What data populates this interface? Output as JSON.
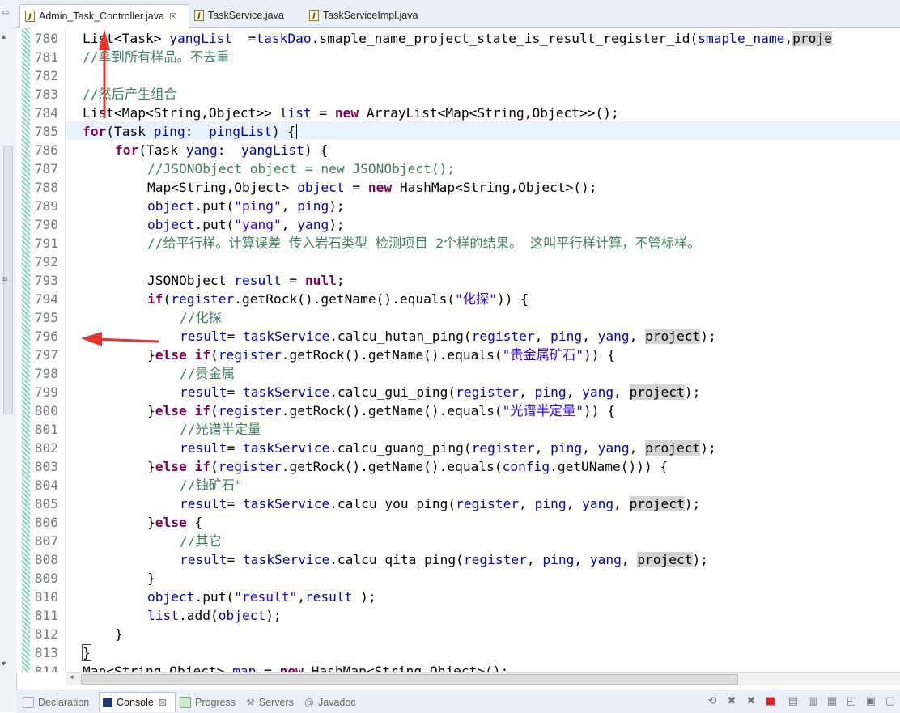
{
  "tabs": [
    {
      "label": "Admin_Task_Controller.java",
      "active": true,
      "close": "☒"
    },
    {
      "label": "TaskService.java",
      "active": false
    },
    {
      "label": "TaskServiceImpl.java",
      "active": false
    }
  ],
  "bottom_tabs": [
    {
      "label": "Declaration"
    },
    {
      "label": "Console",
      "active": true,
      "close": "☒"
    },
    {
      "label": "Progress"
    },
    {
      "label": "Servers"
    },
    {
      "label": "Javadoc"
    }
  ],
  "colors": {
    "keyword": "#7f0055",
    "comment": "#3f7f5f",
    "string": "#2a00ff",
    "field": "#0000c0",
    "annotation_arrow": "#e8322c"
  },
  "code_lines": [
    {
      "n": "780",
      "indent": 2,
      "tokens": [
        [
          "t",
          "List<Task> "
        ],
        [
          "f",
          "yangList"
        ],
        [
          "t",
          "  ="
        ],
        [
          "f",
          "taskDao"
        ],
        [
          "t",
          ".smaple_name_project_state_is_result_register_id("
        ],
        [
          "f",
          "smaple_name"
        ],
        [
          "t",
          ","
        ],
        [
          "h",
          "proje"
        ]
      ]
    },
    {
      "n": "781",
      "indent": 2,
      "tokens": [
        [
          "c",
          "//拿到所有样品。不去重"
        ]
      ]
    },
    {
      "n": "782",
      "indent": 0,
      "tokens": []
    },
    {
      "n": "783",
      "indent": 2,
      "tokens": [
        [
          "c",
          "//然后产生组合"
        ]
      ]
    },
    {
      "n": "784",
      "indent": 2,
      "tokens": [
        [
          "t",
          "List<Map<String,Object>> "
        ],
        [
          "f",
          "list"
        ],
        [
          "t",
          " = "
        ],
        [
          "k",
          "new"
        ],
        [
          "t",
          " ArrayList<Map<String,Object>>();"
        ]
      ]
    },
    {
      "n": "785",
      "indent": 2,
      "tokens": [
        [
          "k",
          "for"
        ],
        [
          "t",
          "(Task "
        ],
        [
          "f",
          "ping"
        ],
        [
          "t",
          ":  "
        ],
        [
          "f",
          "pingList"
        ],
        [
          "t",
          ") {"
        ],
        [
          "caret",
          ""
        ]
      ]
    },
    {
      "n": "786",
      "indent": 3,
      "tokens": [
        [
          "k",
          "for"
        ],
        [
          "t",
          "(Task "
        ],
        [
          "f",
          "yang"
        ],
        [
          "t",
          ":  "
        ],
        [
          "f",
          "yangList"
        ],
        [
          "t",
          ") {"
        ]
      ]
    },
    {
      "n": "787",
      "indent": 4,
      "tokens": [
        [
          "c",
          "//JSONObject object = new JSONObject();"
        ]
      ]
    },
    {
      "n": "788",
      "indent": 4,
      "tokens": [
        [
          "t",
          "Map<String,Object> "
        ],
        [
          "f",
          "object"
        ],
        [
          "t",
          " = "
        ],
        [
          "k",
          "new"
        ],
        [
          "t",
          " HashMap<String,Object>();"
        ]
      ]
    },
    {
      "n": "789",
      "indent": 4,
      "tokens": [
        [
          "f",
          "object"
        ],
        [
          "t",
          ".put("
        ],
        [
          "s",
          "\"ping\""
        ],
        [
          "t",
          ", "
        ],
        [
          "f",
          "ping"
        ],
        [
          "t",
          ");"
        ]
      ]
    },
    {
      "n": "790",
      "indent": 4,
      "tokens": [
        [
          "f",
          "object"
        ],
        [
          "t",
          ".put("
        ],
        [
          "s",
          "\"yang\""
        ],
        [
          "t",
          ", "
        ],
        [
          "f",
          "yang"
        ],
        [
          "t",
          ");"
        ]
      ]
    },
    {
      "n": "791",
      "indent": 4,
      "tokens": [
        [
          "c",
          "//给平行样。计算误差 传入岩石类型 检测项目 2个样的结果。 这叫平行样计算，不管标样。"
        ]
      ]
    },
    {
      "n": "792",
      "indent": 0,
      "tokens": []
    },
    {
      "n": "793",
      "indent": 4,
      "tokens": [
        [
          "t",
          "JSONObject "
        ],
        [
          "f",
          "result"
        ],
        [
          "t",
          " = "
        ],
        [
          "k",
          "null"
        ],
        [
          "t",
          ";"
        ]
      ]
    },
    {
      "n": "794",
      "indent": 4,
      "tokens": [
        [
          "k",
          "if"
        ],
        [
          "t",
          "("
        ],
        [
          "f",
          "register"
        ],
        [
          "t",
          ".getRock().getName().equals("
        ],
        [
          "s",
          "\"化探\""
        ],
        [
          "t",
          ")) {"
        ]
      ]
    },
    {
      "n": "795",
      "indent": 5,
      "tokens": [
        [
          "c",
          "//化探"
        ]
      ]
    },
    {
      "n": "796",
      "indent": 5,
      "tokens": [
        [
          "f",
          "result"
        ],
        [
          "t",
          "= "
        ],
        [
          "d",
          "taskService"
        ],
        [
          "t",
          ".calcu_hutan_ping("
        ],
        [
          "f",
          "register"
        ],
        [
          "t",
          ", "
        ],
        [
          "f",
          "ping"
        ],
        [
          "t",
          ", "
        ],
        [
          "f",
          "yang"
        ],
        [
          "t",
          ", "
        ],
        [
          "h",
          "project"
        ],
        [
          "t",
          ");"
        ]
      ]
    },
    {
      "n": "797",
      "indent": 4,
      "tokens": [
        [
          "t",
          "}"
        ],
        [
          "k",
          "else"
        ],
        [
          "t",
          " "
        ],
        [
          "k",
          "if"
        ],
        [
          "t",
          "("
        ],
        [
          "f",
          "register"
        ],
        [
          "t",
          ".getRock().getName().equals("
        ],
        [
          "s",
          "\"贵金属矿石\""
        ],
        [
          "t",
          ")) {"
        ]
      ]
    },
    {
      "n": "798",
      "indent": 5,
      "tokens": [
        [
          "c",
          "//贵金属"
        ]
      ]
    },
    {
      "n": "799",
      "indent": 5,
      "tokens": [
        [
          "f",
          "result"
        ],
        [
          "t",
          "= "
        ],
        [
          "d",
          "taskService"
        ],
        [
          "t",
          ".calcu_gui_ping("
        ],
        [
          "f",
          "register"
        ],
        [
          "t",
          ", "
        ],
        [
          "f",
          "ping"
        ],
        [
          "t",
          ", "
        ],
        [
          "f",
          "yang"
        ],
        [
          "t",
          ", "
        ],
        [
          "h",
          "project"
        ],
        [
          "t",
          ");"
        ]
      ]
    },
    {
      "n": "800",
      "indent": 4,
      "tokens": [
        [
          "t",
          "}"
        ],
        [
          "k",
          "else"
        ],
        [
          "t",
          " "
        ],
        [
          "k",
          "if"
        ],
        [
          "t",
          "("
        ],
        [
          "f",
          "register"
        ],
        [
          "t",
          ".getRock().getName().equals("
        ],
        [
          "s",
          "\"光谱半定量\""
        ],
        [
          "t",
          ")) {"
        ]
      ]
    },
    {
      "n": "801",
      "indent": 5,
      "tokens": [
        [
          "c",
          "//光谱半定量"
        ]
      ]
    },
    {
      "n": "802",
      "indent": 5,
      "tokens": [
        [
          "f",
          "result"
        ],
        [
          "t",
          "= "
        ],
        [
          "d",
          "taskService"
        ],
        [
          "t",
          ".calcu_guang_ping("
        ],
        [
          "f",
          "register"
        ],
        [
          "t",
          ", "
        ],
        [
          "f",
          "ping"
        ],
        [
          "t",
          ", "
        ],
        [
          "f",
          "yang"
        ],
        [
          "t",
          ", "
        ],
        [
          "h",
          "project"
        ],
        [
          "t",
          ");"
        ]
      ]
    },
    {
      "n": "803",
      "indent": 4,
      "tokens": [
        [
          "t",
          "}"
        ],
        [
          "k",
          "else"
        ],
        [
          "t",
          " "
        ],
        [
          "k",
          "if"
        ],
        [
          "t",
          "("
        ],
        [
          "f",
          "register"
        ],
        [
          "t",
          ".getRock().getName().equals("
        ],
        [
          "f",
          "config"
        ],
        [
          "t",
          ".getUName())) {"
        ]
      ]
    },
    {
      "n": "804",
      "indent": 5,
      "tokens": [
        [
          "c",
          "//铀矿石\""
        ]
      ]
    },
    {
      "n": "805",
      "indent": 5,
      "tokens": [
        [
          "f",
          "result"
        ],
        [
          "t",
          "= "
        ],
        [
          "d",
          "taskService"
        ],
        [
          "t",
          ".calcu_you_ping("
        ],
        [
          "f",
          "register"
        ],
        [
          "t",
          ", "
        ],
        [
          "f",
          "ping"
        ],
        [
          "t",
          ", "
        ],
        [
          "f",
          "yang"
        ],
        [
          "t",
          ", "
        ],
        [
          "h",
          "project"
        ],
        [
          "t",
          ");"
        ]
      ]
    },
    {
      "n": "806",
      "indent": 4,
      "tokens": [
        [
          "t",
          "}"
        ],
        [
          "k",
          "else"
        ],
        [
          "t",
          " {"
        ]
      ]
    },
    {
      "n": "807",
      "indent": 5,
      "tokens": [
        [
          "c",
          "//其它"
        ]
      ]
    },
    {
      "n": "808",
      "indent": 5,
      "tokens": [
        [
          "f",
          "result"
        ],
        [
          "t",
          "= "
        ],
        [
          "d",
          "taskService"
        ],
        [
          "t",
          ".calcu_qita_ping("
        ],
        [
          "f",
          "register"
        ],
        [
          "t",
          ", "
        ],
        [
          "f",
          "ping"
        ],
        [
          "t",
          ", "
        ],
        [
          "f",
          "yang"
        ],
        [
          "t",
          ", "
        ],
        [
          "h",
          "project"
        ],
        [
          "t",
          ");"
        ]
      ]
    },
    {
      "n": "809",
      "indent": 4,
      "tokens": [
        [
          "t",
          "}"
        ]
      ]
    },
    {
      "n": "810",
      "indent": 4,
      "tokens": [
        [
          "f",
          "object"
        ],
        [
          "t",
          ".put("
        ],
        [
          "s",
          "\"result\""
        ],
        [
          "t",
          ","
        ],
        [
          "f",
          "result"
        ],
        [
          "t",
          " );"
        ]
      ]
    },
    {
      "n": "811",
      "indent": 4,
      "tokens": [
        [
          "f",
          "list"
        ],
        [
          "t",
          ".add("
        ],
        [
          "f",
          "object"
        ],
        [
          "t",
          ");"
        ]
      ]
    },
    {
      "n": "812",
      "indent": 3,
      "tokens": [
        [
          "t",
          "}"
        ]
      ]
    },
    {
      "n": "813",
      "indent": 2,
      "tokens": [
        [
          "b",
          "}"
        ]
      ]
    },
    {
      "n": "814",
      "indent": 2,
      "tokens": [
        [
          "t",
          "Map<String,Object> "
        ],
        [
          "f",
          "map"
        ],
        [
          "t",
          " = "
        ],
        [
          "k",
          "new"
        ],
        [
          "t",
          " HashMap<String,Object>();"
        ]
      ]
    }
  ]
}
